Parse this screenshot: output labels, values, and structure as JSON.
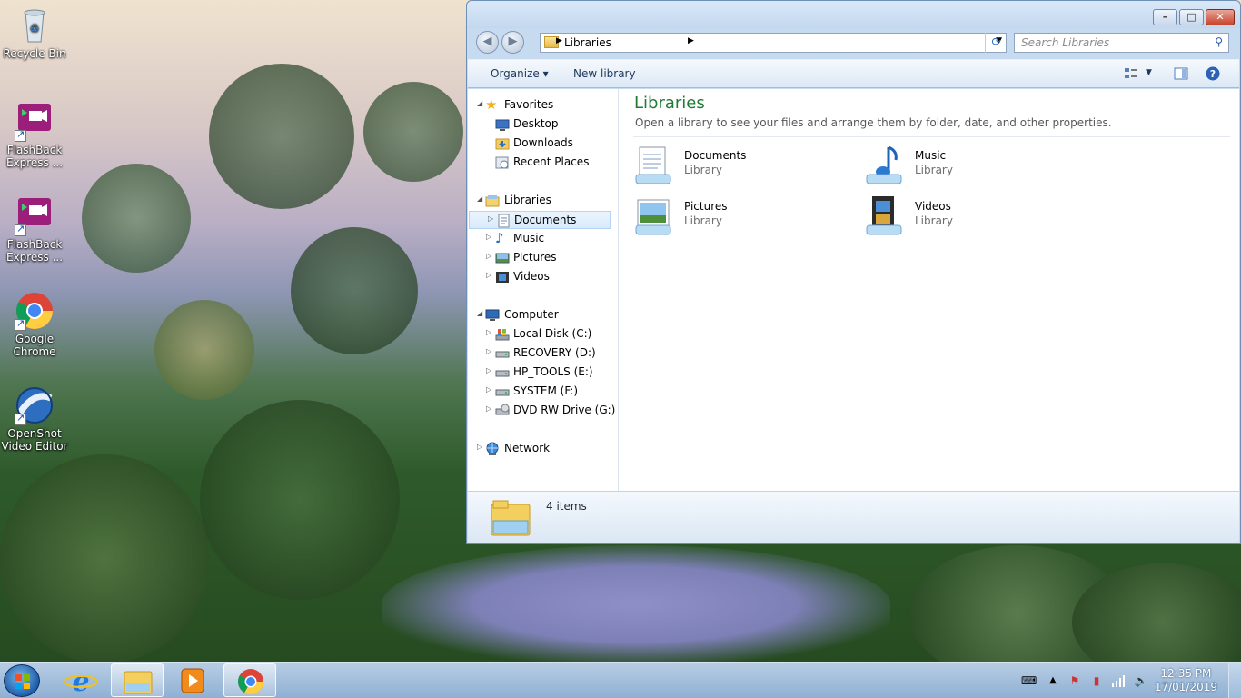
{
  "desktop": {
    "icons": [
      {
        "label": "Recycle Bin",
        "icon": "recycle-bin-icon"
      },
      {
        "label": "FlashBack Express ...",
        "icon": "flashback-icon"
      },
      {
        "label": "FlashBack Express ...",
        "icon": "flashback-icon"
      },
      {
        "label": "Google Chrome",
        "icon": "chrome-icon"
      },
      {
        "label": "OpenShot Video Editor",
        "icon": "openshot-icon"
      }
    ]
  },
  "window": {
    "caption": {
      "minimize": "–",
      "maximize": "□",
      "close": "✕"
    },
    "address": {
      "crumb": "Libraries"
    },
    "search": {
      "placeholder": "Search Libraries"
    },
    "toolbar": {
      "organize": "Organize",
      "new_library": "New library"
    },
    "nav": {
      "favorites": {
        "label": "Favorites",
        "items": [
          "Desktop",
          "Downloads",
          "Recent Places"
        ]
      },
      "libraries": {
        "label": "Libraries",
        "items": [
          "Documents",
          "Music",
          "Pictures",
          "Videos"
        ]
      },
      "computer": {
        "label": "Computer",
        "items": [
          "Local Disk (C:)",
          "RECOVERY (D:)",
          "HP_TOOLS (E:)",
          "SYSTEM (F:)",
          "DVD RW Drive (G:) G"
        ]
      },
      "network": {
        "label": "Network"
      }
    },
    "content": {
      "title": "Libraries",
      "subtitle": "Open a library to see your files and arrange them by folder, date, and other properties.",
      "libraries": [
        {
          "name": "Documents",
          "type": "Library"
        },
        {
          "name": "Music",
          "type": "Library"
        },
        {
          "name": "Pictures",
          "type": "Library"
        },
        {
          "name": "Videos",
          "type": "Library"
        }
      ]
    },
    "details": {
      "count": "4 items"
    }
  },
  "taskbar": {
    "clock": {
      "time": "12:35 PM",
      "date": "17/01/2019"
    }
  },
  "colors": {
    "accent_green": "#1e7a34",
    "selection": "#d9ebfb"
  }
}
